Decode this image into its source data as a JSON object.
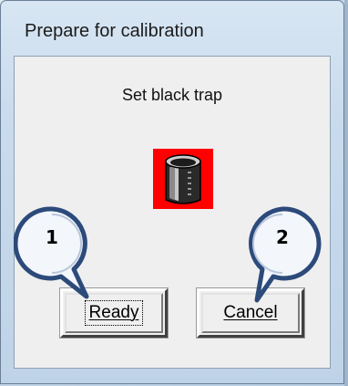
{
  "window": {
    "title": "Prepare for calibration"
  },
  "dialog": {
    "message": "Set black trap",
    "icon": "black-trap-icon"
  },
  "buttons": {
    "ready_label": "Ready",
    "cancel_label": "Cancel"
  },
  "callouts": [
    {
      "number": "1"
    },
    {
      "number": "2"
    }
  ],
  "colors": {
    "icon_background": "#ff0000",
    "callout_fill": "#f3f6fb",
    "callout_border": "#2c4a7a"
  }
}
